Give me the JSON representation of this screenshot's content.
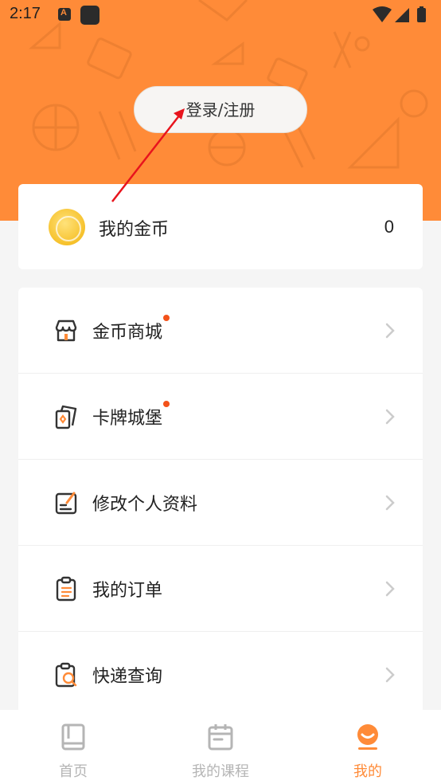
{
  "status_bar": {
    "time": "2:17"
  },
  "header": {
    "login_label": "登录/注册",
    "accent_color": "#ff8b38"
  },
  "coins": {
    "label": "我的金币",
    "value": "0"
  },
  "menu": {
    "items": [
      {
        "label": "金币商城",
        "icon": "store-icon",
        "has_badge": true
      },
      {
        "label": "卡牌城堡",
        "icon": "cards-icon",
        "has_badge": true
      },
      {
        "label": "修改个人资料",
        "icon": "edit-profile-icon",
        "has_badge": false
      },
      {
        "label": "我的订单",
        "icon": "order-clipboard-icon",
        "has_badge": false
      },
      {
        "label": "快递查询",
        "icon": "delivery-search-icon",
        "has_badge": false
      }
    ]
  },
  "tabbar": {
    "tabs": [
      {
        "label": "首页",
        "icon": "book-icon",
        "active": false
      },
      {
        "label": "我的课程",
        "icon": "calendar-icon",
        "active": false
      },
      {
        "label": "我的",
        "icon": "smile-face-icon",
        "active": true
      }
    ]
  }
}
